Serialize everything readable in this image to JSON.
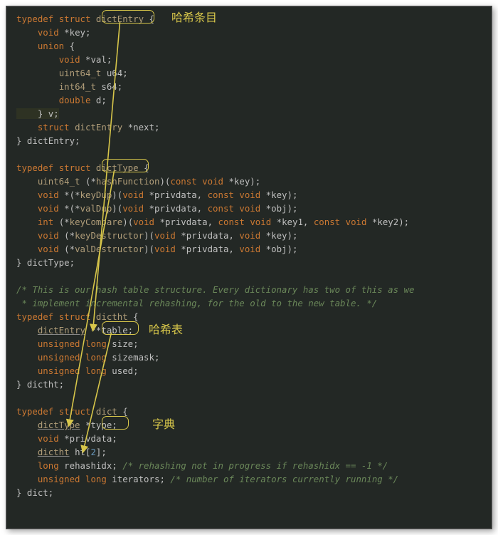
{
  "annotations": {
    "dictEntry_box_label": "哈希条目",
    "dictType_box_label": "",
    "dictht_box_label": "哈希表",
    "dict_box_label": "字典"
  },
  "code": {
    "dictEntry": {
      "decl": "typedef struct dictEntry {",
      "key": "    void *key;",
      "union_open": "    union {",
      "val": "        void *val;",
      "u64": "        uint64_t u64;",
      "s64": "        int64_t s64;",
      "d": "        double d;",
      "union_close": "    } v;",
      "next": "    struct dictEntry *next;",
      "close": "} dictEntry;"
    },
    "dictType": {
      "decl": "typedef struct dictType {",
      "hashFunction": "    uint64_t (*hashFunction)(const void *key);",
      "keyDup": "    void *(*keyDup)(void *privdata, const void *key);",
      "valDup": "    void *(*valDup)(void *privdata, const void *obj);",
      "keyCompare": "    int (*keyCompare)(void *privdata, const void *key1, const void *key2);",
      "keyDestructor": "    void (*keyDestructor)(void *privdata, void *key);",
      "valDestructor": "    void (*valDestructor)(void *privdata, void *obj);",
      "close": "} dictType;"
    },
    "comment1": "/* This is our hash table structure. Every dictionary has two of this as we",
    "comment2": " * implement incremental rehashing, for the old to the new table. */",
    "dictht": {
      "decl": "typedef struct dictht {",
      "table": "    dictEntry **table;",
      "size": "    unsigned long size;",
      "sizemask": "    unsigned long sizemask;",
      "used": "    unsigned long used;",
      "close": "} dictht;"
    },
    "dict": {
      "decl": "typedef struct dict {",
      "type": "    dictType *type;",
      "privdata": "    void *privdata;",
      "ht": "    dictht ht[2];",
      "rehashidx": "    long rehashidx; /* rehashing not in progress if rehashidx == -1 */",
      "iterators": "    unsigned long iterators; /* number of iterators currently running */",
      "close": "} dict;"
    }
  }
}
